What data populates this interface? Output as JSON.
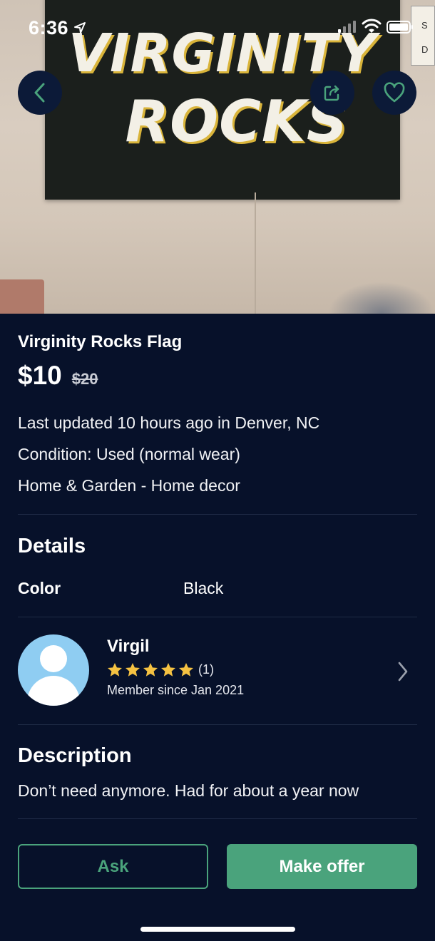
{
  "status_bar": {
    "time": "6:36"
  },
  "photo": {
    "flag_line1": "VIRGINITY",
    "flag_line2": "ROCKS",
    "wall_sign": "S\nD"
  },
  "listing": {
    "title": "Virginity Rocks Flag",
    "price": "$10",
    "original_price": "$20",
    "updated": "Last updated 10 hours ago in Denver, NC",
    "condition": "Condition: Used (normal wear)",
    "category": "Home & Garden - Home decor"
  },
  "details": {
    "heading": "Details",
    "color_label": "Color",
    "color_value": "Black"
  },
  "seller": {
    "name": "Virgil",
    "rating": 5,
    "rating_count": "(1)",
    "member_since": "Member since Jan 2021"
  },
  "description": {
    "heading": "Description",
    "text": "Don’t need anymore. Had for about a year now"
  },
  "actions": {
    "ask_label": "Ask",
    "offer_label": "Make offer"
  },
  "icons": {
    "back": "chevron-left-icon",
    "share": "share-icon",
    "favorite": "heart-icon",
    "seller_nav": "chevron-right-icon",
    "location": "location-arrow-icon"
  },
  "colors": {
    "background": "#07112a",
    "accent": "#4aa37c",
    "star": "#f5c242",
    "avatar_bg": "#8fcdf2"
  }
}
